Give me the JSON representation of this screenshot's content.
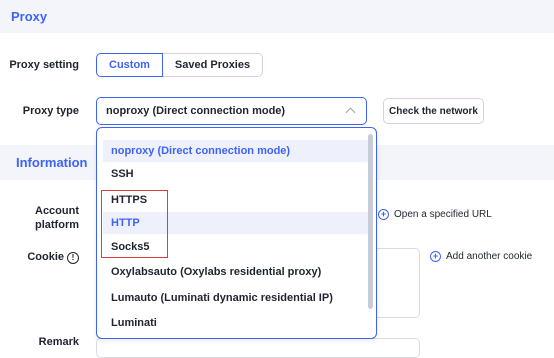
{
  "sections": {
    "proxy": {
      "title": "Proxy"
    },
    "information": {
      "title": "Information"
    }
  },
  "proxy_setting": {
    "label": "Proxy setting",
    "tabs": [
      "Custom",
      "Saved Proxies"
    ],
    "active_tab": "Custom"
  },
  "proxy_type": {
    "label": "Proxy type",
    "selected": "noproxy (Direct connection mode)",
    "options": [
      "noproxy (Direct connection mode)",
      "SSH",
      "HTTPS",
      "HTTP",
      "Socks5",
      "Oxylabsauto (Oxylabs residential proxy)",
      "Lumauto (Luminati dynamic residential IP)",
      "Luminati"
    ]
  },
  "check_network": {
    "label": "Check the network"
  },
  "account_platform": {
    "label_line1": "Account",
    "label_line2": "platform",
    "open_url_label": "Open a specified URL"
  },
  "cookie": {
    "label": "Cookie",
    "add_cookie_label": "Add another cookie"
  },
  "remark": {
    "label": "Remark"
  },
  "colors": {
    "accent": "#3d63f5",
    "highlight_border": "#e03c3c",
    "section_bg": "#f3f5fa"
  }
}
